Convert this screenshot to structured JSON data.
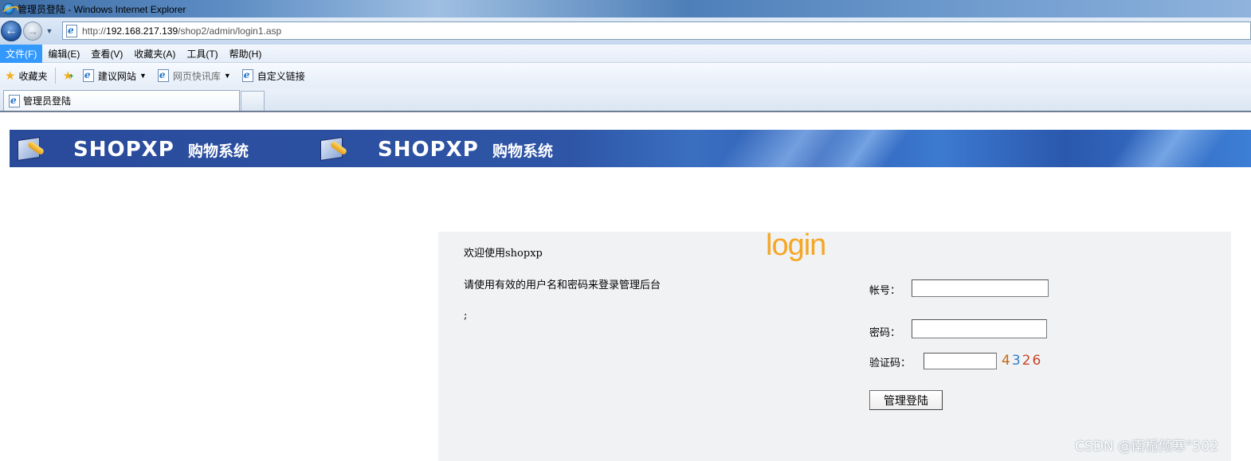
{
  "window": {
    "title": "管理员登陆 - Windows Internet Explorer"
  },
  "address_bar": {
    "url_prefix": "http://",
    "url_host": "192.168.217.139",
    "url_path": "/shop2/admin/login1.asp"
  },
  "menu": {
    "items": [
      "文件(F)",
      "编辑(E)",
      "查看(V)",
      "收藏夹(A)",
      "工具(T)",
      "帮助(H)"
    ]
  },
  "favorites_bar": {
    "favorites_label": "收藏夹",
    "suggested_sites": "建议网站",
    "web_slice_gallery": "网页快讯库",
    "custom_links": "自定义链接"
  },
  "tabs": {
    "active_tab": "管理员登陆"
  },
  "banner": {
    "brand": "SHOPXP",
    "subtitle": "购物系统"
  },
  "login": {
    "logo_text": "login",
    "welcome": "欢迎使用shopxp",
    "instruction": "请使用有效的用户名和密码来登录管理后台",
    "semicolon": ";",
    "account_label": "帐号：",
    "password_label": "密码：",
    "captcha_label": "验证码：",
    "captcha_code": [
      "4",
      "3",
      "2",
      "6"
    ],
    "account_value": "",
    "password_value": "",
    "captcha_value": "",
    "submit_label": "管理登陆"
  },
  "watermark": "CSDN @南栀倾寒°502",
  "colors": {
    "menu_active": "#3399ff",
    "banner_blue": "#2e55a6",
    "login_logo": "#f5a623",
    "panel_bg": "#f0f2f4"
  }
}
